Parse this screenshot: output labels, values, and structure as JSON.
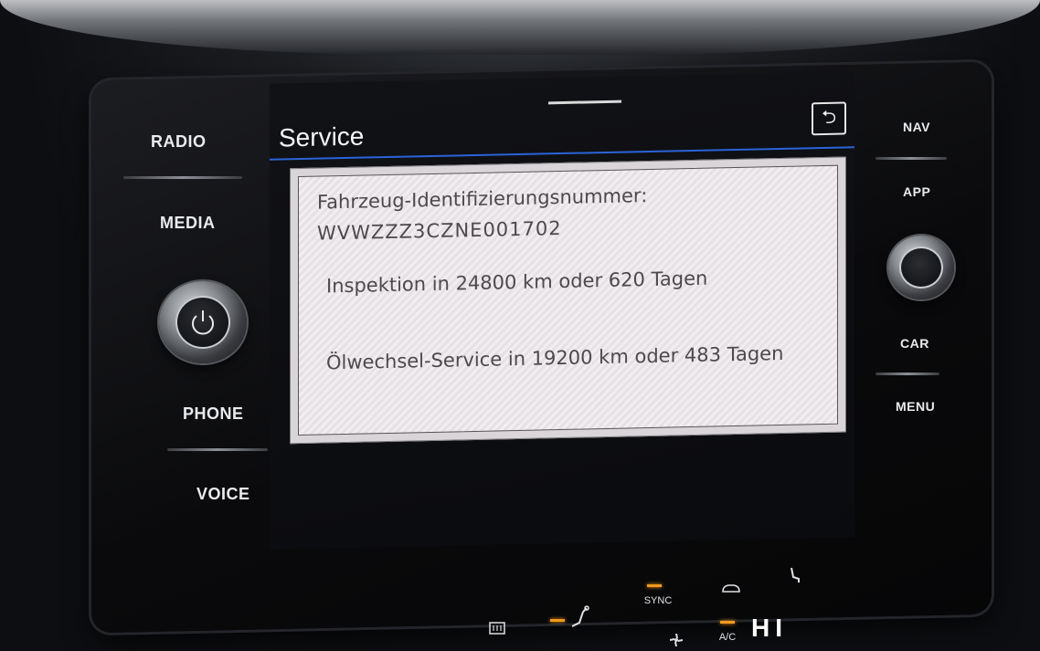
{
  "side_left": {
    "items": [
      {
        "label": "RADIO"
      },
      {
        "label": "MEDIA"
      },
      {
        "label": "PHONE"
      },
      {
        "label": "VOICE"
      }
    ],
    "power_icon": "power-icon"
  },
  "side_right": {
    "items": [
      {
        "label": "NAV"
      },
      {
        "label": "APP"
      },
      {
        "label": "CAR"
      },
      {
        "label": "MENU"
      }
    ]
  },
  "screen": {
    "title": "Service",
    "back_icon": "back-arrow-icon",
    "back_symbol": "⮌",
    "accent_color": "#2b63d9",
    "panel": {
      "vin_label": "Fahrzeug-Identifizierungsnummer:",
      "vin_value": "WVWZZZ3CZNE001702",
      "inspection": "Inspektion in 24800 km oder 620 Tagen",
      "oil_service": "Ölwechsel-Service in 19200 km oder 483 Tagen"
    }
  },
  "climate": {
    "sync_label": "SYNC",
    "ac_label": "A/C",
    "temperature": "HI",
    "indicator_color": "#f29a1d",
    "icons": [
      "seat-airflow-icon",
      "car-recirculation-icon",
      "heated-seat-icon",
      "rear-defrost-icon",
      "fan-icon"
    ]
  }
}
